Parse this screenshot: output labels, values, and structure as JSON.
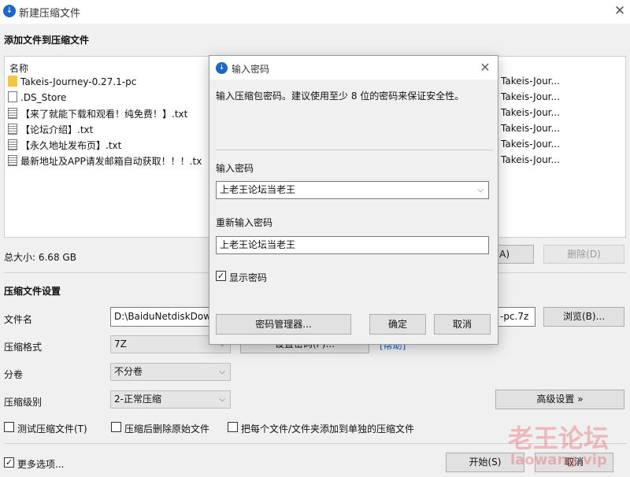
{
  "window": {
    "title": "新建压缩文件",
    "app_icon": "download-arrow-icon"
  },
  "files_section": {
    "heading": "添加文件到压缩文件",
    "column_name": "名称",
    "files": [
      {
        "name": "Takeis-Journey-0.27.1-pc",
        "icon": "folder-icon",
        "path": "Takeis-Jour..."
      },
      {
        "name": ".DS_Store",
        "icon": "file-icon",
        "path": "Takeis-Jour..."
      },
      {
        "name": "【来了就能下载和观看！纯免费！】.txt",
        "icon": "text-file-icon",
        "path": "Takeis-Jour..."
      },
      {
        "name": "【论坛介绍】.txt",
        "icon": "text-file-icon",
        "path": "Takeis-Jour..."
      },
      {
        "name": "【永久地址发布页】.txt",
        "icon": "text-file-icon",
        "path": "Takeis-Jour..."
      },
      {
        "name": "最新地址及APP请发邮箱自动获取！！！.tx",
        "icon": "text-file-icon",
        "path": "Takeis-Jour..."
      }
    ],
    "total_size": "总大小: 6.68 GB",
    "add_button": "(A)",
    "delete_button": "删除(D)"
  },
  "settings": {
    "heading": "压缩文件设置",
    "filename_label": "文件名",
    "filename_value": "D:\\BaiduNetdiskDow",
    "filename_suffix": "-pc.7z",
    "browse_button": "浏览(B)...",
    "format_label": "压缩格式",
    "format_value": "7Z",
    "set_password_button": "设置密码(P)...",
    "help_link": "[帮助]",
    "split_label": "分卷",
    "split_value": "不分卷",
    "level_label": "压缩级别",
    "level_value": "2-正常压缩",
    "advanced_button": "高级设置 »",
    "options": [
      {
        "label": "测试压缩文件(T)",
        "checked": false
      },
      {
        "label": "压缩后删除原始文件",
        "checked": false
      },
      {
        "label": "把每个文件/文件夹添加到单独的压缩文件",
        "checked": false
      }
    ],
    "more_options": {
      "label": "更多选项...",
      "checked": true
    },
    "start_button": "开始(S)",
    "cancel_button": "取消"
  },
  "password_dialog": {
    "title": "输入密码",
    "description": "输入压缩包密码。建议使用至少 8 位的密码来保证安全性。",
    "password_label": "输入密码",
    "password_value": "上老王论坛当老王",
    "repeat_label": "重新输入密码",
    "repeat_value": "上老王论坛当老王",
    "show_password_label": "显示密码",
    "show_password_checked": true,
    "manager_button": "密码管理器...",
    "ok_button": "确定",
    "cancel_button": "取消"
  },
  "watermark": {
    "line1": "老王论坛",
    "line2": "laowang.vip"
  },
  "colors": {
    "accent": "#1a66c9",
    "link": "#1a5fd0",
    "watermark": "#e6505a"
  }
}
